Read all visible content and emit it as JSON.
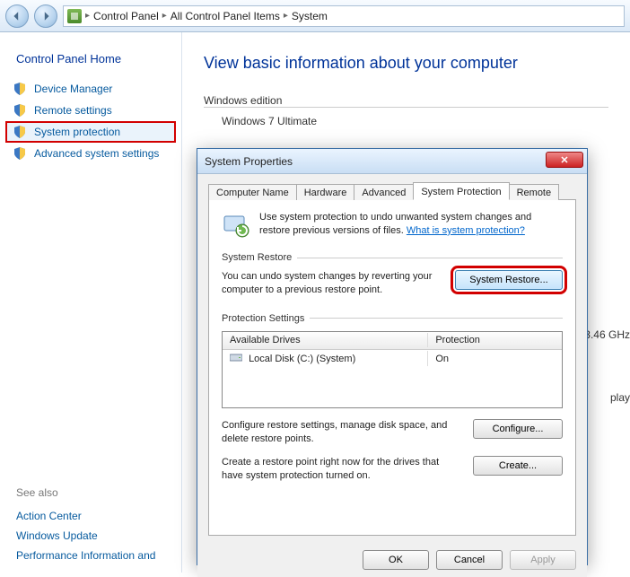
{
  "breadcrumbs": {
    "root": "Control Panel",
    "mid": "All Control Panel Items",
    "leaf": "System"
  },
  "sidebar": {
    "home": "Control Panel Home",
    "links": [
      {
        "label": "Device Manager"
      },
      {
        "label": "Remote settings"
      },
      {
        "label": "System protection"
      },
      {
        "label": "Advanced system settings"
      }
    ],
    "see_also_title": "See also",
    "see_also": [
      "Action Center",
      "Windows Update",
      "Performance Information and"
    ]
  },
  "content": {
    "heading": "View basic information about your computer",
    "edition_label": "Windows edition",
    "edition_value": "Windows 7 Ultimate",
    "cpu_suffix": "3.46 GHz",
    "display_suffix": "play"
  },
  "dialog": {
    "title": "System Properties",
    "tabs": [
      "Computer Name",
      "Hardware",
      "Advanced",
      "System Protection",
      "Remote"
    ],
    "intro": "Use system protection to undo unwanted system changes and restore previous versions of files. ",
    "intro_link": "What is system protection?",
    "system_restore_label": "System Restore",
    "restore_text": "You can undo system changes by reverting your computer to a previous restore point.",
    "restore_button": "System Restore...",
    "protection_settings_label": "Protection Settings",
    "drives_header": {
      "col1": "Available Drives",
      "col2": "Protection"
    },
    "drives": [
      {
        "name": "Local Disk (C:) (System)",
        "protection": "On"
      }
    ],
    "configure_text": "Configure restore settings, manage disk space, and delete restore points.",
    "configure_button": "Configure...",
    "create_text": "Create a restore point right now for the drives that have system protection turned on.",
    "create_button": "Create...",
    "ok": "OK",
    "cancel": "Cancel",
    "apply": "Apply"
  }
}
